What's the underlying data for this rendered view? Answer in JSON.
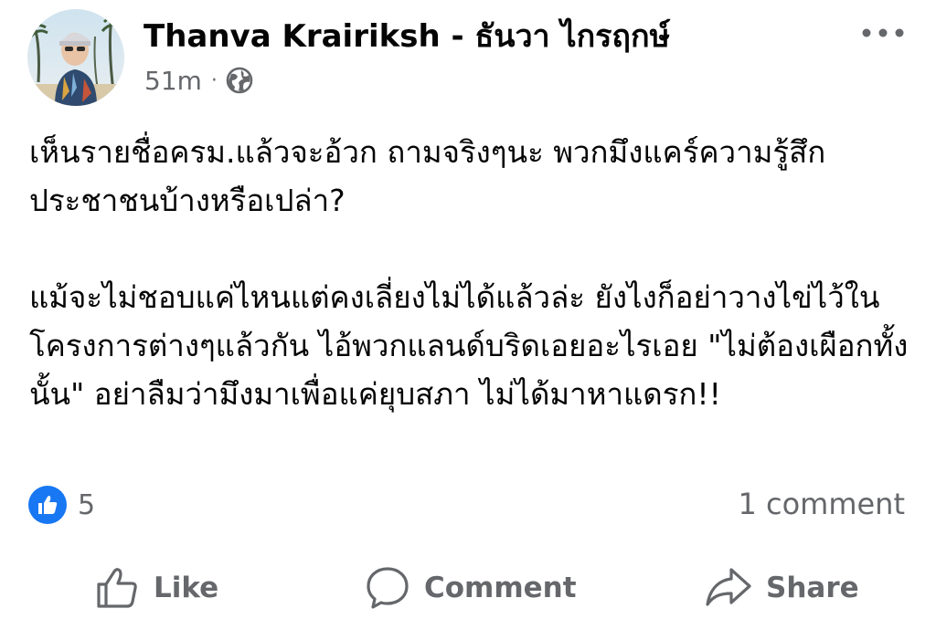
{
  "post": {
    "author_name": "Thanva Krairiksh - ธันวา ไกรฤกษ์",
    "time": "51m",
    "separator": "·",
    "audience_icon": "globe-icon",
    "more_icon": "more-horizontal-icon",
    "paragraph_1": "เห็นรายชื่อครม.แล้วจะอ้วก ถามจริงๆนะ พวกมึงแคร์ความรู้สึกประชาชนบ้างหรือเปล่า?",
    "paragraph_2": "แม้จะไม่ชอบแค่ไหนแต่คงเลี่ยงไม่ได้แล้วล่ะ ยังไงก็อย่าวางไข่ไว้ในโครงการต่างๆแล้วกัน ไอ้พวกแลนด์บริดเอยอะไรเอย \"ไม่ต้องเผือกทั้งนั้น\" อย่าลืมว่ามึงมาเพื่อแค่ยุบสภา ไม่ได้มาหาแดรก!!"
  },
  "engagement": {
    "reaction_icon": "like-reaction-icon",
    "reaction_count": "5",
    "comment_count": "1 comment"
  },
  "actions": {
    "like_label": "Like",
    "comment_label": "Comment",
    "share_label": "Share"
  },
  "colors": {
    "text_primary": "#050505",
    "text_secondary": "#65676b",
    "like_blue": "#1877f2",
    "background": "#ffffff"
  }
}
